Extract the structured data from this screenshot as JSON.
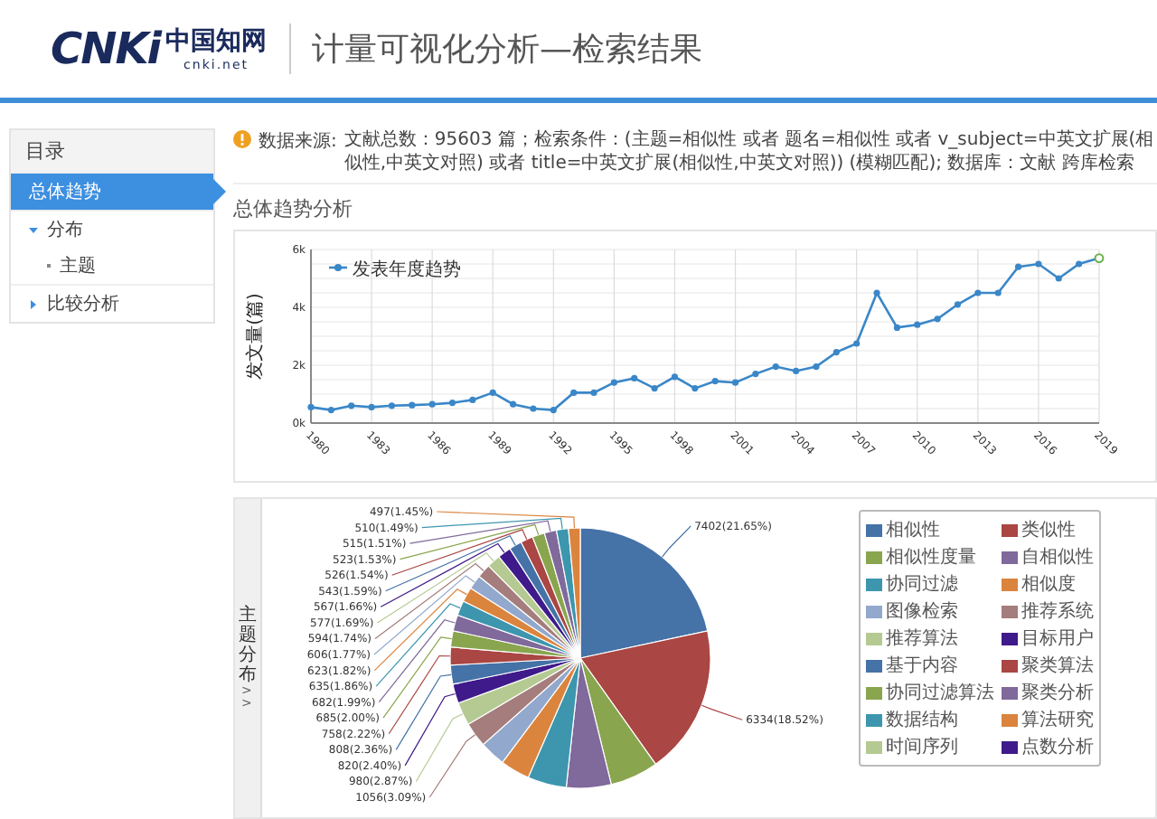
{
  "header": {
    "logo": {
      "mark": "CNKi",
      "name": "中国知网",
      "domain": "cnki.net"
    },
    "title": "计量可视化分析—检索结果"
  },
  "sidebar": {
    "title": "目录",
    "items": [
      {
        "label": "总体趋势",
        "selected": true
      },
      {
        "label": "分布",
        "selected": false,
        "expanded": true,
        "children": [
          {
            "label": "主题",
            "selected": false
          }
        ]
      },
      {
        "label": "比较分析",
        "selected": false,
        "expanded": false
      }
    ]
  },
  "source": {
    "label": "数据来源:",
    "text": "文献总数：95603 篇；检索条件：(主题=相似性 或者 题名=相似性 或者 v_subject=中英文扩展(相似性,中英文对照) 或者 title=中英文扩展(相似性,中英文对照)) (模糊匹配); 数据库：文献 跨库检索"
  },
  "trend": {
    "heading": "总体趋势分析",
    "chart_data": {
      "type": "line",
      "ylabel": "发文量(篇)",
      "x": [
        1980,
        1981,
        1982,
        1983,
        1984,
        1985,
        1986,
        1987,
        1988,
        1989,
        1990,
        1991,
        1992,
        1993,
        1994,
        1995,
        1996,
        1997,
        1998,
        1999,
        2000,
        2001,
        2002,
        2003,
        2004,
        2005,
        2006,
        2007,
        2008,
        2009,
        2010,
        2011,
        2012,
        2013,
        2014,
        2015,
        2016,
        2017,
        2018,
        2019
      ],
      "xlim": [
        1980,
        2019
      ],
      "grid": true,
      "xticks": [
        1980,
        1983,
        1986,
        1989,
        1992,
        1995,
        1998,
        2001,
        2004,
        2007,
        2010,
        2013,
        2016,
        2019
      ],
      "ylim": [
        0,
        6000
      ],
      "yticks": [
        {
          "value": 0,
          "label": "0k"
        },
        {
          "value": 2000,
          "label": "2k"
        },
        {
          "value": 4000,
          "label": "4k"
        },
        {
          "value": 6000,
          "label": "6k"
        }
      ],
      "series": [
        {
          "name": "发表年度趋势",
          "color": "#3a87c8",
          "marker": "circle",
          "values": [
            550,
            450,
            600,
            550,
            600,
            620,
            650,
            700,
            800,
            1050,
            650,
            500,
            450,
            1050,
            1050,
            1400,
            1550,
            1200,
            1600,
            1200,
            1450,
            1400,
            1700,
            1950,
            1800,
            1950,
            2450,
            2750,
            4500,
            3300,
            3400,
            3600,
            4100,
            4500,
            4500,
            5400,
            5500,
            5000,
            5500,
            5700
          ]
        }
      ]
    }
  },
  "topic": {
    "tab": {
      "label": "主题分布",
      "arrow": ">>"
    },
    "chart_data": {
      "type": "pie",
      "values": [
        7402,
        6334,
        2050,
        1900,
        1650,
        1250,
        1100,
        1056,
        980,
        820,
        808,
        758,
        685,
        682,
        635,
        623,
        606,
        594,
        577,
        567,
        543,
        526,
        523,
        515,
        510,
        497
      ],
      "value_labels": [
        "7402(21.65%)",
        "6334(18.52%)",
        null,
        null,
        null,
        null,
        null,
        "1056(3.09%)",
        "980(2.87%)",
        "820(2.40%)",
        "808(2.36%)",
        "758(2.22%)",
        "685(2.00%)",
        "682(1.99%)",
        "635(1.86%)",
        "623(1.82%)",
        "606(1.77%)",
        "594(1.74%)",
        "577(1.69%)",
        "567(1.66%)",
        "543(1.59%)",
        "526(1.54%)",
        "523(1.53%)",
        "515(1.51%)",
        "510(1.49%)",
        "497(1.45%)"
      ]
    },
    "legend": [
      {
        "name": "相似性",
        "color": "#4572a7"
      },
      {
        "name": "类似性",
        "color": "#aa4643"
      },
      {
        "name": "相似性度量",
        "color": "#89a54e"
      },
      {
        "name": "自相似性",
        "color": "#80699b"
      },
      {
        "name": "协同过滤",
        "color": "#3d96ae"
      },
      {
        "name": "相似度",
        "color": "#db843d"
      },
      {
        "name": "图像检索",
        "color": "#92a8cd"
      },
      {
        "name": "推荐系统",
        "color": "#a47d7c"
      },
      {
        "name": "推荐算法",
        "color": "#b5ca92"
      },
      {
        "name": "目标用户",
        "color": "#3f1a8a"
      },
      {
        "name": "基于内容",
        "color": "#4572a7"
      },
      {
        "name": "聚类算法",
        "color": "#aa4643"
      },
      {
        "name": "协同过滤算法",
        "color": "#89a54e"
      },
      {
        "name": "聚类分析",
        "color": "#80699b"
      },
      {
        "name": "数据结构",
        "color": "#3d96ae"
      },
      {
        "name": "算法研究",
        "color": "#db843d"
      },
      {
        "name": "时间序列",
        "color": "#b5ca92"
      },
      {
        "name": "点数分析",
        "color": "#3f1a8a"
      }
    ]
  }
}
